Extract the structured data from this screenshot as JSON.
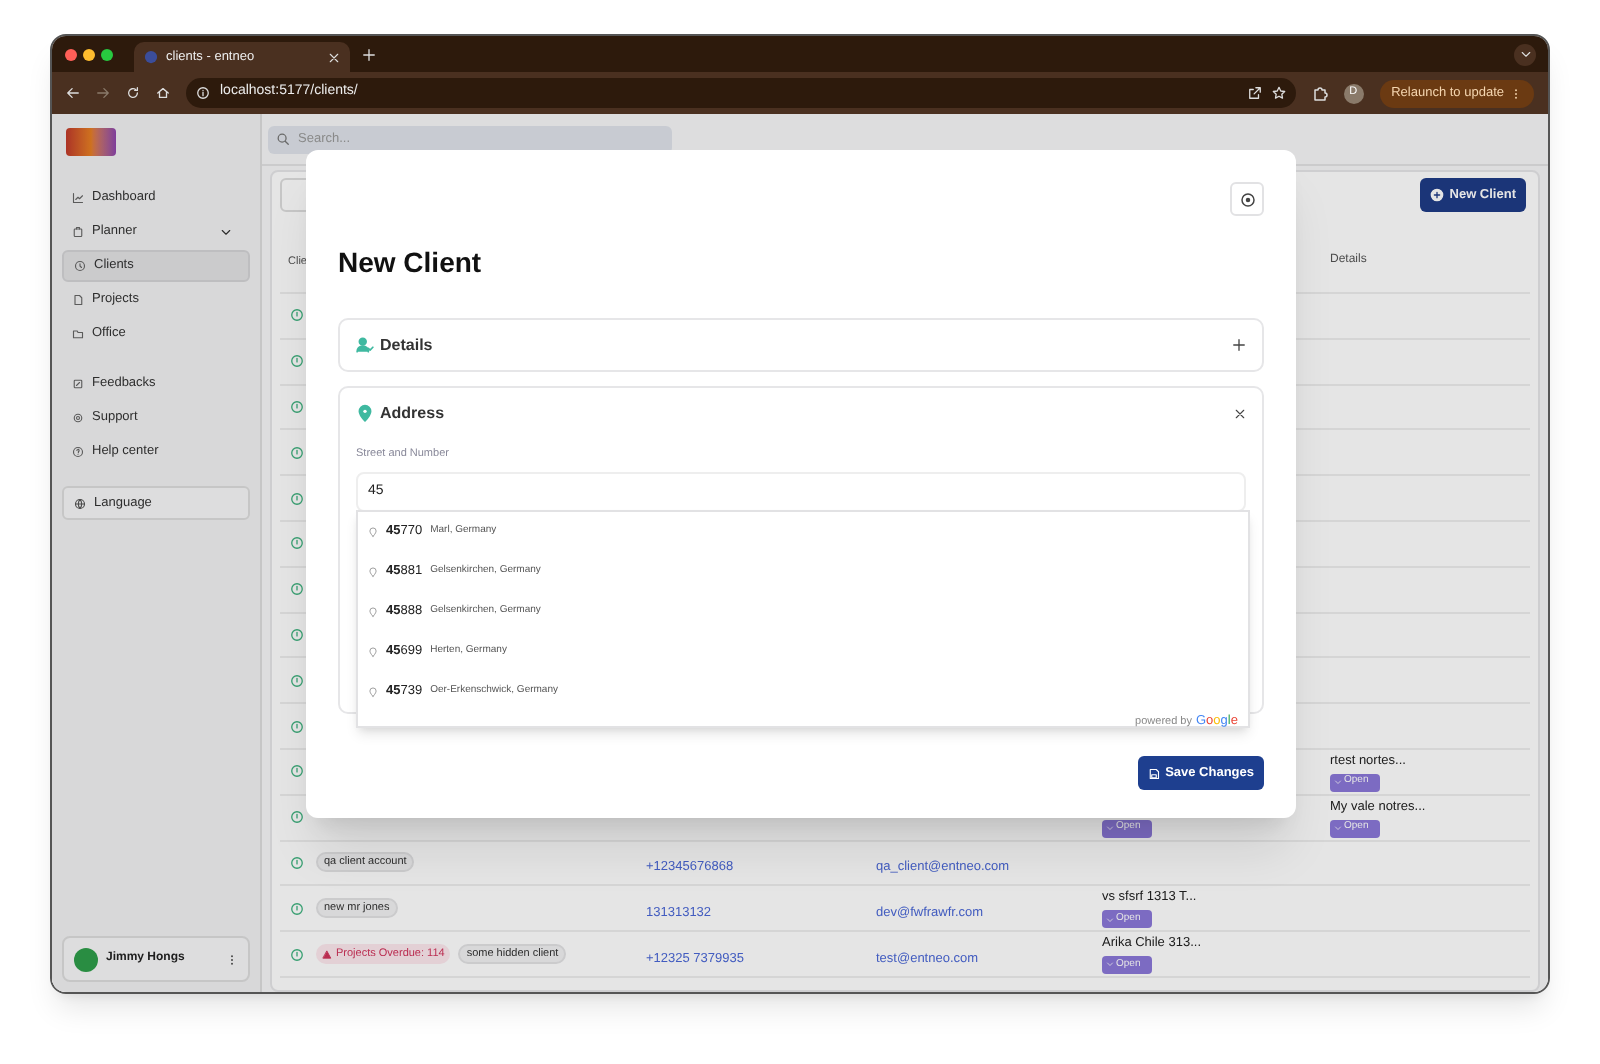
{
  "browser": {
    "tab_title": "clients - entneo",
    "url": "localhost:5177/clients/",
    "profile_initial": "D",
    "relaunch_label": "Relaunch to update"
  },
  "sidebar": {
    "primary_items": [
      {
        "label": "Dashboard",
        "selected": false
      },
      {
        "label": "Planner",
        "selected": false,
        "expanded": false
      },
      {
        "label": "Clients",
        "selected": true
      },
      {
        "label": "Projects",
        "selected": false
      },
      {
        "label": "Office",
        "selected": false
      }
    ],
    "secondary_items": [
      {
        "label": "Feedbacks",
        "selected": false
      },
      {
        "label": "Support",
        "selected": false
      },
      {
        "label": "Help center",
        "selected": false
      }
    ],
    "language_label": "Language",
    "user": {
      "name": "Jimmy Hongs"
    }
  },
  "search": {
    "placeholder": "Search..."
  },
  "page": {
    "new_client_label": "New Client"
  },
  "table": {
    "columns": {
      "column_1": "Clie",
      "column_6": "Details"
    },
    "rows": [
      {},
      {},
      {},
      {},
      {},
      {},
      {},
      {},
      {},
      {},
      {
        "details": {
          "text": "rtest nortes...",
          "open_label": "Open"
        }
      },
      {
        "notes": {
          "open_label": "Open"
        },
        "details": {
          "text": "My vale notres...",
          "open_label": "Open"
        }
      },
      {
        "name": "qa client account",
        "phone": "+12345676868",
        "email": "qa_client@entneo.com"
      },
      {
        "name": "new mr jones",
        "phone": "131313132",
        "email": "dev@fwfrawfr.com",
        "notes": {
          "text": "vs sfsrf 1313 T...",
          "open_label": "Open"
        }
      },
      {
        "alert": "Projects Overdue: 114",
        "name": "some hidden client",
        "phone": "+12325 7379935",
        "email": "test@entneo.com",
        "notes": {
          "text": "Arika Chile 313...",
          "open_label": "Open"
        }
      }
    ]
  },
  "modal": {
    "title": "New Client",
    "sections": [
      {
        "title": "Details",
        "expanded": false
      },
      {
        "title": "Address",
        "expanded": true
      }
    ],
    "street_label": "Street and Number",
    "street_value": "45",
    "suggestions": [
      {
        "main": "**45**770",
        "secondary": "Marl, Germany"
      },
      {
        "main": "**45**881",
        "secondary": "Gelsenkirchen, Germany"
      },
      {
        "main": "**45**888",
        "secondary": "Gelsenkirchen, Germany"
      },
      {
        "main": "**45**699",
        "secondary": "Herten, Germany"
      },
      {
        "main": "**45**739",
        "secondary": "Oer-Erkenschwick, Germany"
      }
    ],
    "attribution": "powered by",
    "attribution_brand": "Google",
    "save_label": "Save Changes"
  }
}
